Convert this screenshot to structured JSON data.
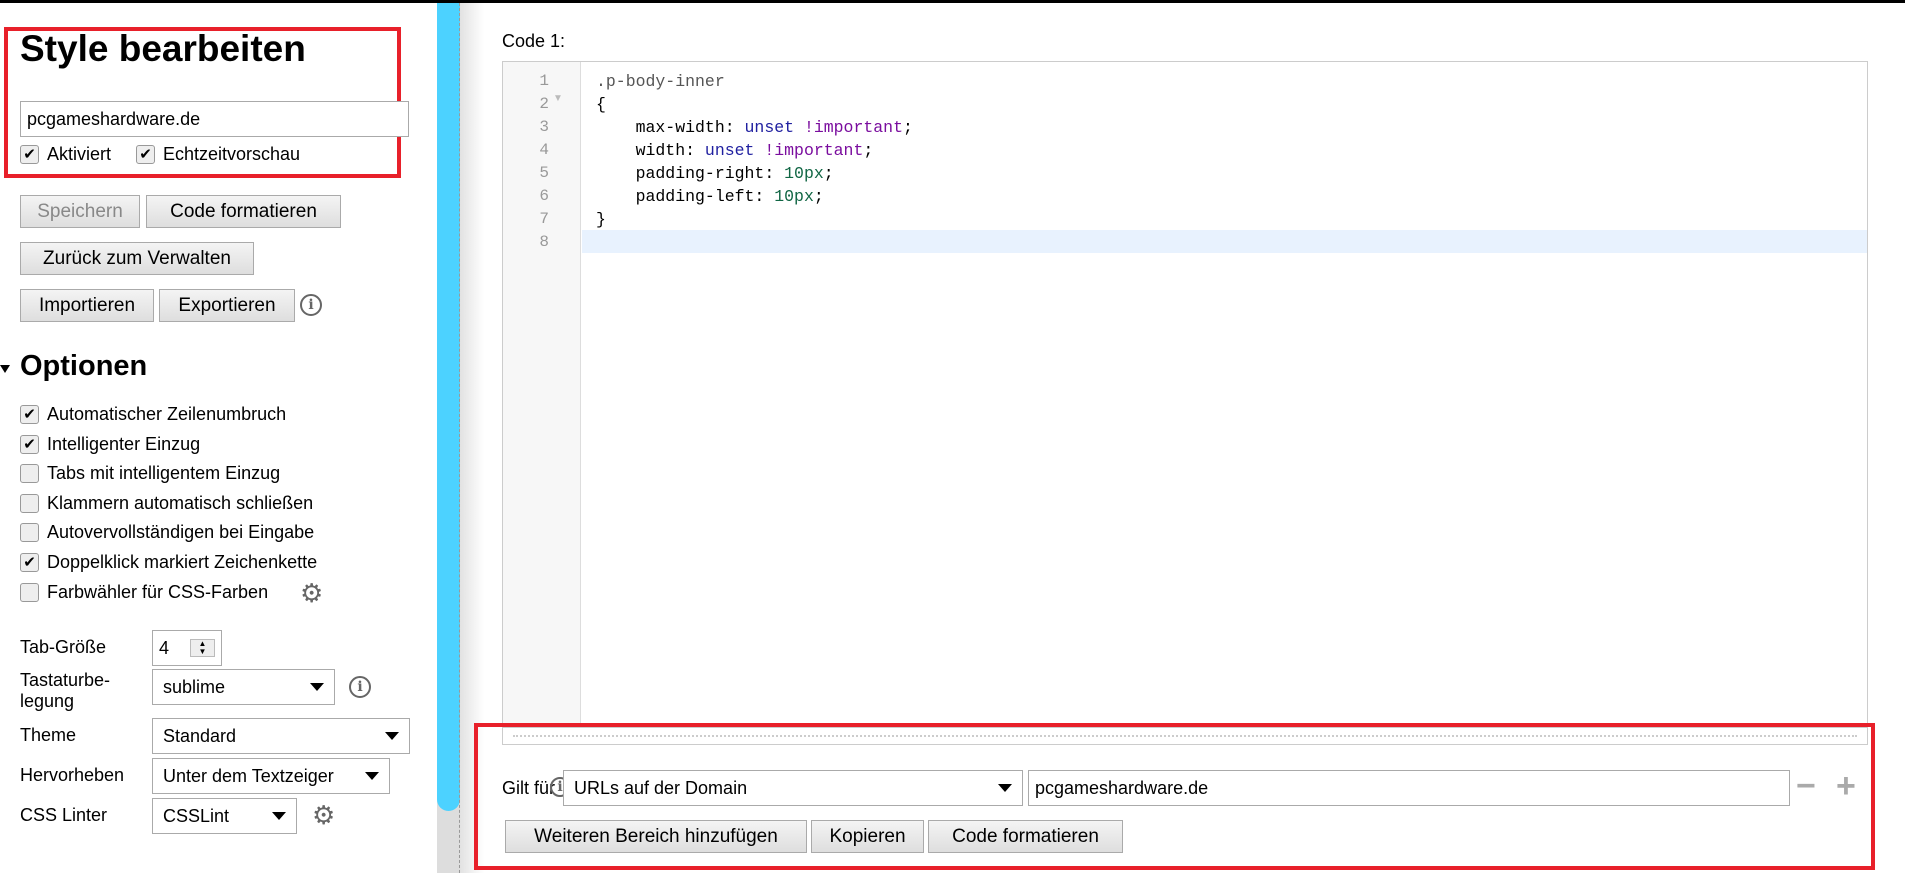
{
  "left": {
    "title": "Style bearbeiten",
    "name_value": "pcgameshardware.de",
    "enabled_label": "Aktiviert",
    "enabled": true,
    "live_preview_label": "Echtzeitvorschau",
    "live_preview": true,
    "buttons": {
      "save": "Speichern",
      "beautify": "Code formatieren",
      "back": "Zurück zum Verwalten",
      "import": "Importieren",
      "export": "Exportieren"
    },
    "options_heading": "Optionen",
    "options": [
      {
        "label": "Automatischer Zeilenumbruch",
        "checked": true
      },
      {
        "label": "Intelligenter Einzug",
        "checked": true
      },
      {
        "label": "Tabs mit intelligentem Einzug",
        "checked": false
      },
      {
        "label": "Klammern automatisch schließen",
        "checked": false
      },
      {
        "label": "Autovervollständigen bei Eingabe",
        "checked": false
      },
      {
        "label": "Doppelklick markiert Zeichenkette",
        "checked": true
      },
      {
        "label": "Farbwähler für CSS-Farben",
        "checked": false
      }
    ],
    "settings": {
      "tab_size_label": "Tab-Größe",
      "tab_size": "4",
      "keymap_label_1": "Tastaturbe-",
      "keymap_label_2": "legung",
      "keymap": "sublime",
      "theme_label": "Theme",
      "theme": "Standard",
      "highlight_label": "Hervorheben",
      "highlight": "Unter dem Textzeiger",
      "linter_label": "CSS Linter",
      "linter": "CSSLint"
    }
  },
  "main": {
    "code_label": "Code 1:",
    "line_numbers": [
      "1",
      "2",
      "3",
      "4",
      "5",
      "6",
      "7",
      "8"
    ],
    "code": {
      "l1": ".p-body-inner",
      "l2": "{",
      "l3_prop": "    max-width: ",
      "l3_val": "unset",
      "l3_imp": "!important",
      "l3_end": ";",
      "l4_prop": "    width: ",
      "l4_val": "unset",
      "l4_imp": "!important",
      "l4_end": ";",
      "l5_prop": "    padding-right: ",
      "l5_val": "10px",
      "l5_end": ";",
      "l6_prop": "    padding-left: ",
      "l6_val": "10px",
      "l6_end": ";",
      "l7": "}"
    },
    "applies_label": "Gilt für",
    "applies_type": "URLs auf der Domain",
    "applies_value": "pcgameshardware.de",
    "buttons": {
      "add_section": "Weiteren Bereich hinzufügen",
      "copy": "Kopieren",
      "beautify": "Code formatieren"
    },
    "minus": "−",
    "plus": "+"
  },
  "colors": {
    "highlight_box": "#e8202a",
    "scrollbar": "#4cd2ff",
    "active_line": "#e8f2fe"
  }
}
